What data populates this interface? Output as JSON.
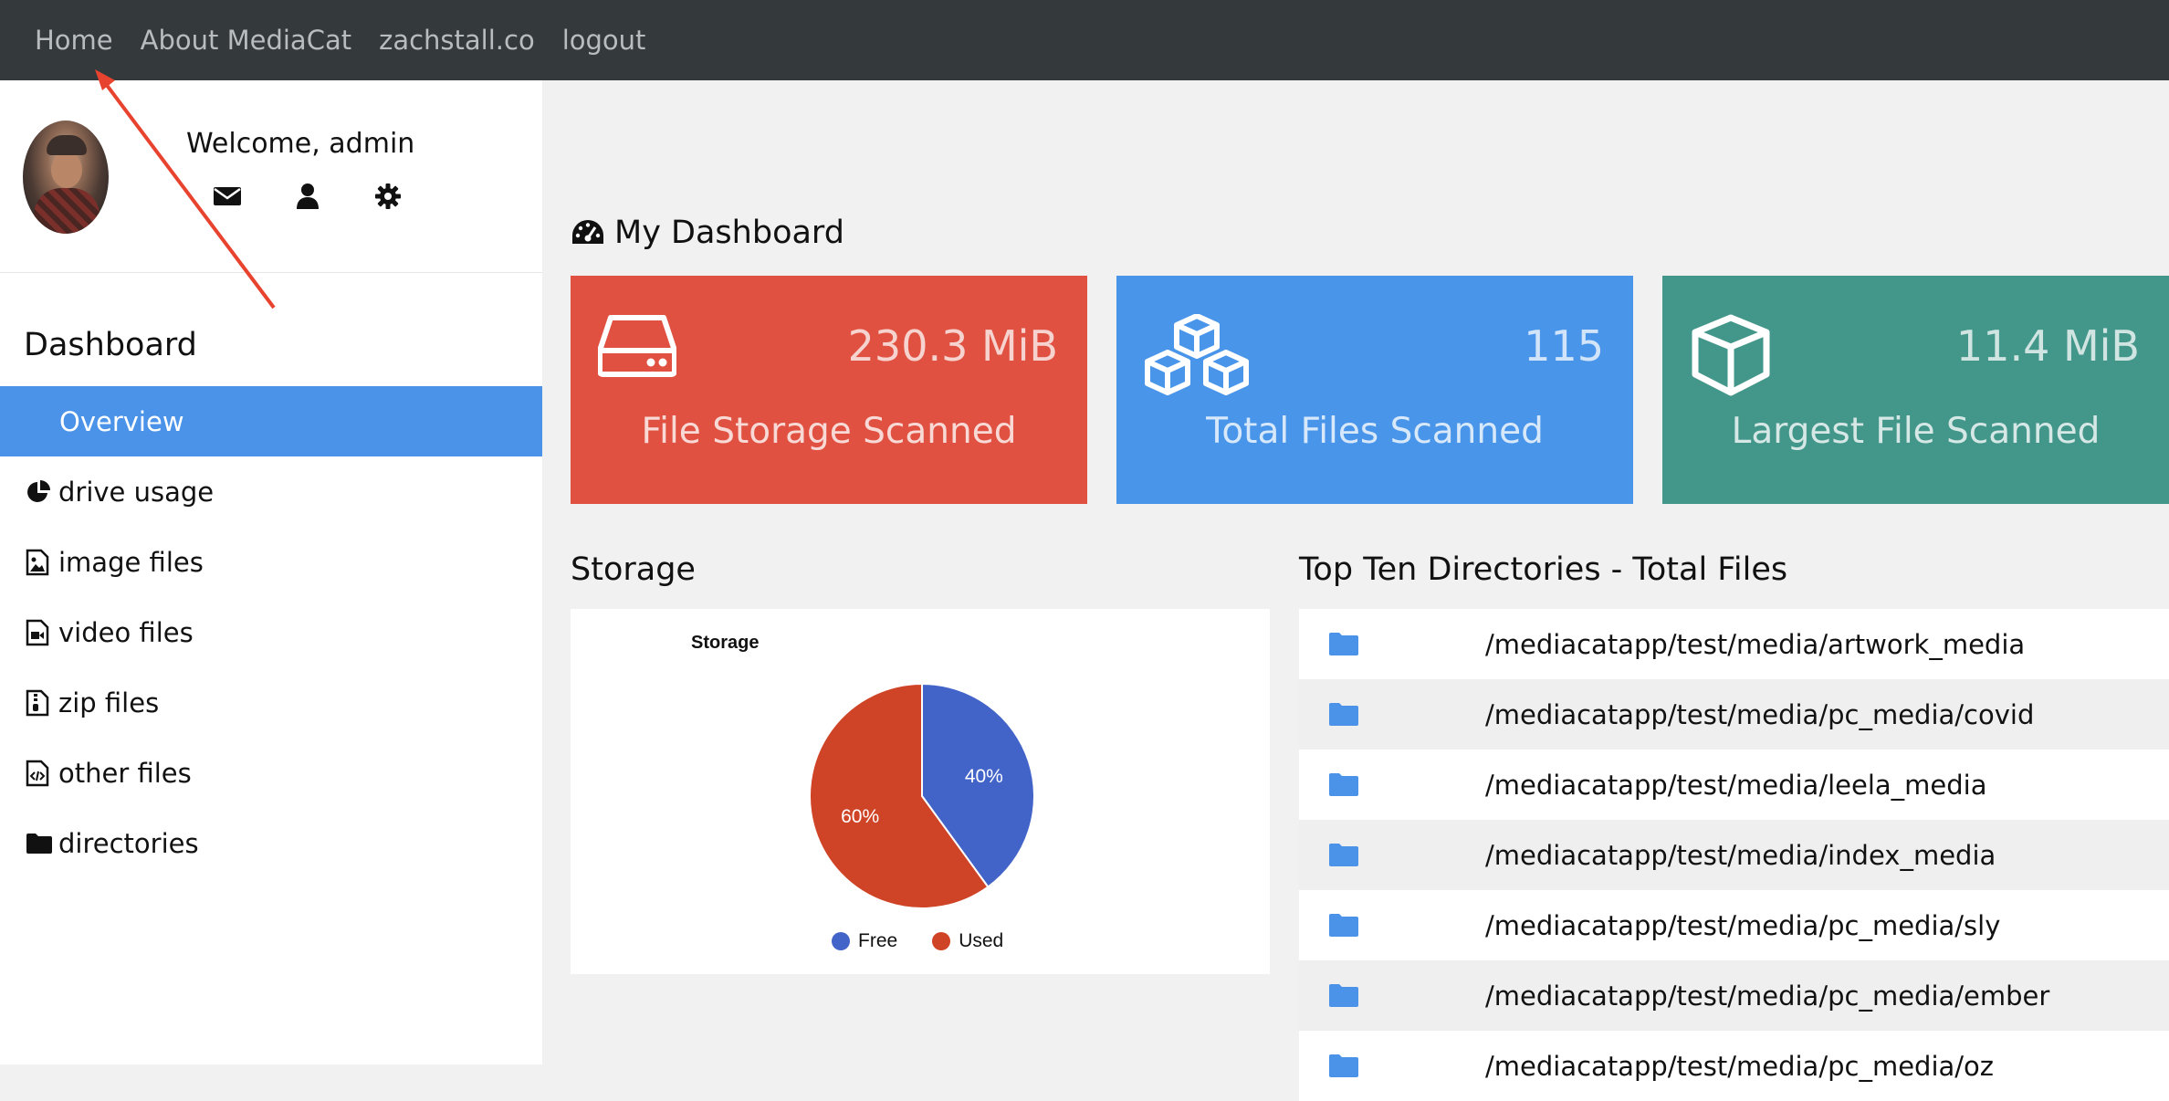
{
  "nav": {
    "links": [
      "Home",
      "About MediaCat",
      "zachstall.co",
      "logout"
    ]
  },
  "profile": {
    "welcome": "Welcome, admin",
    "icons": [
      "envelope-icon",
      "user-icon",
      "gear-icon"
    ]
  },
  "sidebar": {
    "section_title": "Dashboard",
    "items": [
      {
        "label": "Overview",
        "icon": "",
        "active": true
      },
      {
        "label": "drive usage",
        "icon": "pie-chart-icon"
      },
      {
        "label": "image files",
        "icon": "image-file-icon"
      },
      {
        "label": "video files",
        "icon": "video-file-icon"
      },
      {
        "label": "zip files",
        "icon": "zip-file-icon"
      },
      {
        "label": "other files",
        "icon": "code-file-icon"
      },
      {
        "label": "directories",
        "icon": "folder-icon"
      }
    ]
  },
  "main": {
    "title": "My Dashboard",
    "title_icon": "dashboard-gauge-icon",
    "cards": [
      {
        "value": "230.3 MiB",
        "label": "File Storage Scanned",
        "icon": "hard-drive-icon",
        "color": "#e05141"
      },
      {
        "value": "115",
        "label": "Total Files Scanned",
        "icon": "cubes-icon",
        "color": "#4895ea"
      },
      {
        "value": "11.4 MiB",
        "label": "Largest File Scanned",
        "icon": "cube-icon",
        "color": "#43968a"
      }
    ],
    "storage_title": "Storage",
    "directories_title": "Top Ten Directories - Total Files",
    "directories": [
      "/mediacatapp/test/media/artwork_media",
      "/mediacatapp/test/media/pc_media/covid",
      "/mediacatapp/test/media/leela_media",
      "/mediacatapp/test/media/index_media",
      "/mediacatapp/test/media/pc_media/sly",
      "/mediacatapp/test/media/pc_media/ember",
      "/mediacatapp/test/media/pc_media/oz"
    ]
  },
  "chart_data": {
    "type": "pie",
    "title": "Storage",
    "categories": [
      "Free",
      "Used"
    ],
    "values": [
      40,
      60
    ],
    "labels": [
      "40%",
      "60%"
    ],
    "colors": [
      "#4264c8",
      "#cf4426"
    ],
    "legend": "bottom"
  }
}
